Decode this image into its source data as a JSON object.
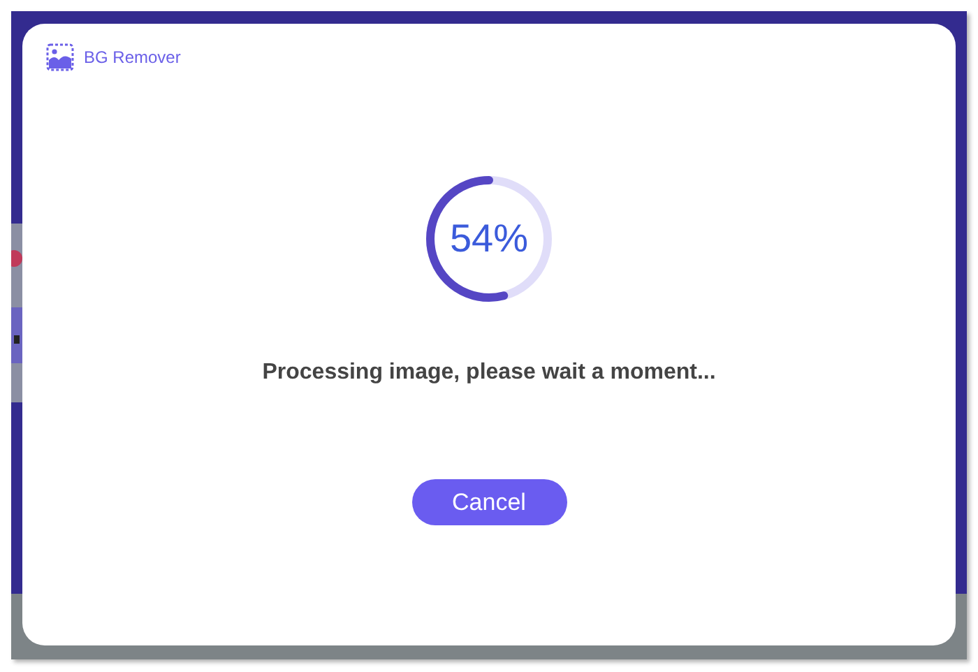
{
  "app": {
    "title": "BG Remover"
  },
  "progress": {
    "level": 0.54,
    "label": "54%"
  },
  "message": "Processing image, please wait a moment...",
  "buttons": [
    {
      "label": "Cancel"
    }
  ]
}
